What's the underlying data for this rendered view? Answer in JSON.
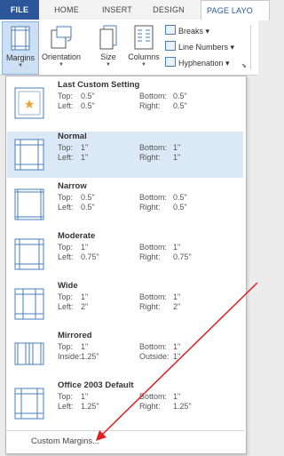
{
  "tabs": {
    "file": "FILE",
    "home": "HOME",
    "insert": "INSERT",
    "design": "DESIGN",
    "page_layout": "PAGE LAYO"
  },
  "ribbon": {
    "margins": "Margins",
    "orientation": "Orientation",
    "size": "Size",
    "columns": "Columns",
    "breaks": "Breaks",
    "line_numbers": "Line Numbers",
    "hyphenation": "Hyphenation"
  },
  "menu": {
    "items": [
      {
        "name": "Last Custom Setting",
        "r1": [
          "Top:",
          "0.5\"",
          "Bottom:",
          "0.5\""
        ],
        "r2": [
          "Left:",
          "0.5\"",
          "Right:",
          "0.5\""
        ]
      },
      {
        "name": "Normal",
        "r1": [
          "Top:",
          "1\"",
          "Bottom:",
          "1\""
        ],
        "r2": [
          "Left:",
          "1\"",
          "Right:",
          "1\""
        ]
      },
      {
        "name": "Narrow",
        "r1": [
          "Top:",
          "0.5\"",
          "Bottom:",
          "0.5\""
        ],
        "r2": [
          "Left:",
          "0.5\"",
          "Right:",
          "0.5\""
        ]
      },
      {
        "name": "Moderate",
        "r1": [
          "Top:",
          "1\"",
          "Bottom:",
          "1\""
        ],
        "r2": [
          "Left:",
          "0.75\"",
          "Right:",
          "0.75\""
        ]
      },
      {
        "name": "Wide",
        "r1": [
          "Top:",
          "1\"",
          "Bottom:",
          "1\""
        ],
        "r2": [
          "Left:",
          "2\"",
          "Right:",
          "2\""
        ]
      },
      {
        "name": "Mirrored",
        "r1": [
          "Top:",
          "1\"",
          "Bottom:",
          "1\""
        ],
        "r2": [
          "Inside:",
          "1.25\"",
          "Outside:",
          "1\""
        ]
      },
      {
        "name": "Office 2003 Default",
        "r1": [
          "Top:",
          "1\"",
          "Bottom:",
          "1\""
        ],
        "r2": [
          "Left:",
          "1.25\"",
          "Right:",
          "1.25\""
        ]
      }
    ],
    "custom_margins": "Custom Margins..."
  },
  "colors": {
    "accent": "#2b579a",
    "annotation_arrow": "#e02020",
    "selected_bg": "#dbe8f6"
  }
}
